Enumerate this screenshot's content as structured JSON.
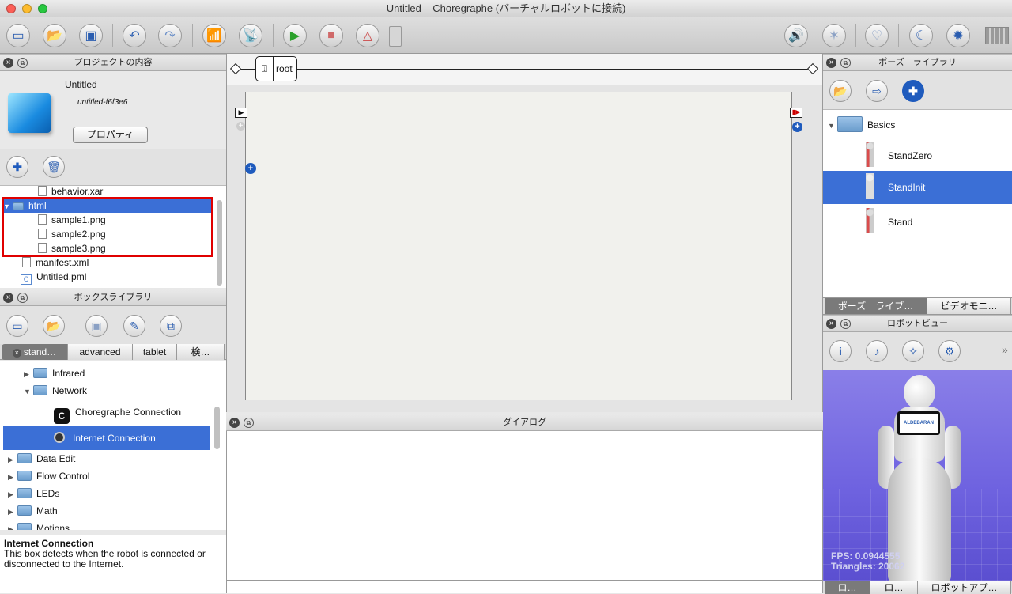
{
  "window": {
    "title": "Untitled – Choregraphe (バーチャルロボットに接続)"
  },
  "project_panel": {
    "header": "プロジェクトの内容",
    "project_name": "Untitled",
    "project_id": "untitled-f6f3e6",
    "properties_button": "プロパティ",
    "files": [
      {
        "name": "behavior.xar",
        "type": "file"
      },
      {
        "name": "html",
        "type": "folder",
        "selected": true
      },
      {
        "name": "sample1.png",
        "type": "image"
      },
      {
        "name": "sample2.png",
        "type": "image"
      },
      {
        "name": "sample3.png",
        "type": "image"
      },
      {
        "name": "manifest.xml",
        "type": "file"
      },
      {
        "name": "Untitled.pml",
        "type": "pml"
      }
    ]
  },
  "box_library": {
    "header": "ボックスライブラリ",
    "tabs": [
      "stand…",
      "advanced",
      "tablet",
      "検…"
    ],
    "tree": [
      {
        "label": "Infrared",
        "kind": "folder",
        "expanded": false
      },
      {
        "label": "Network",
        "kind": "folder",
        "expanded": true
      },
      {
        "label": "Choregraphe Connection",
        "kind": "box"
      },
      {
        "label": "Internet Connection",
        "kind": "box",
        "selected": true
      },
      {
        "label": "Data Edit",
        "kind": "folder",
        "expanded": false
      },
      {
        "label": "Flow Control",
        "kind": "folder",
        "expanded": false
      },
      {
        "label": "LEDs",
        "kind": "folder",
        "expanded": false
      },
      {
        "label": "Math",
        "kind": "folder",
        "expanded": false
      },
      {
        "label": "Motions",
        "kind": "folder",
        "expanded": false
      }
    ],
    "description_title": "Internet Connection",
    "description_text": "This box detects when the robot is connected or disconnected to the Internet."
  },
  "flow": {
    "root_label": "root"
  },
  "dialog_panel": {
    "header": "ダイアログ"
  },
  "pose_library": {
    "header": "ポーズ　ライブラリ",
    "folder": "Basics",
    "poses": [
      "StandZero",
      "StandInit",
      "Stand"
    ],
    "selected": "StandInit",
    "tabs": [
      "ポーズ　ライブ…",
      "ビデオモニ…"
    ]
  },
  "robot_view": {
    "header": "ロボットビュー",
    "fps": "FPS: 0.0944555",
    "triangles": "Triangles: 20062",
    "brand": "ALDEBARAN",
    "bottom_tabs": [
      "ロ…",
      "ロ…",
      "ロボットアプ…"
    ]
  }
}
